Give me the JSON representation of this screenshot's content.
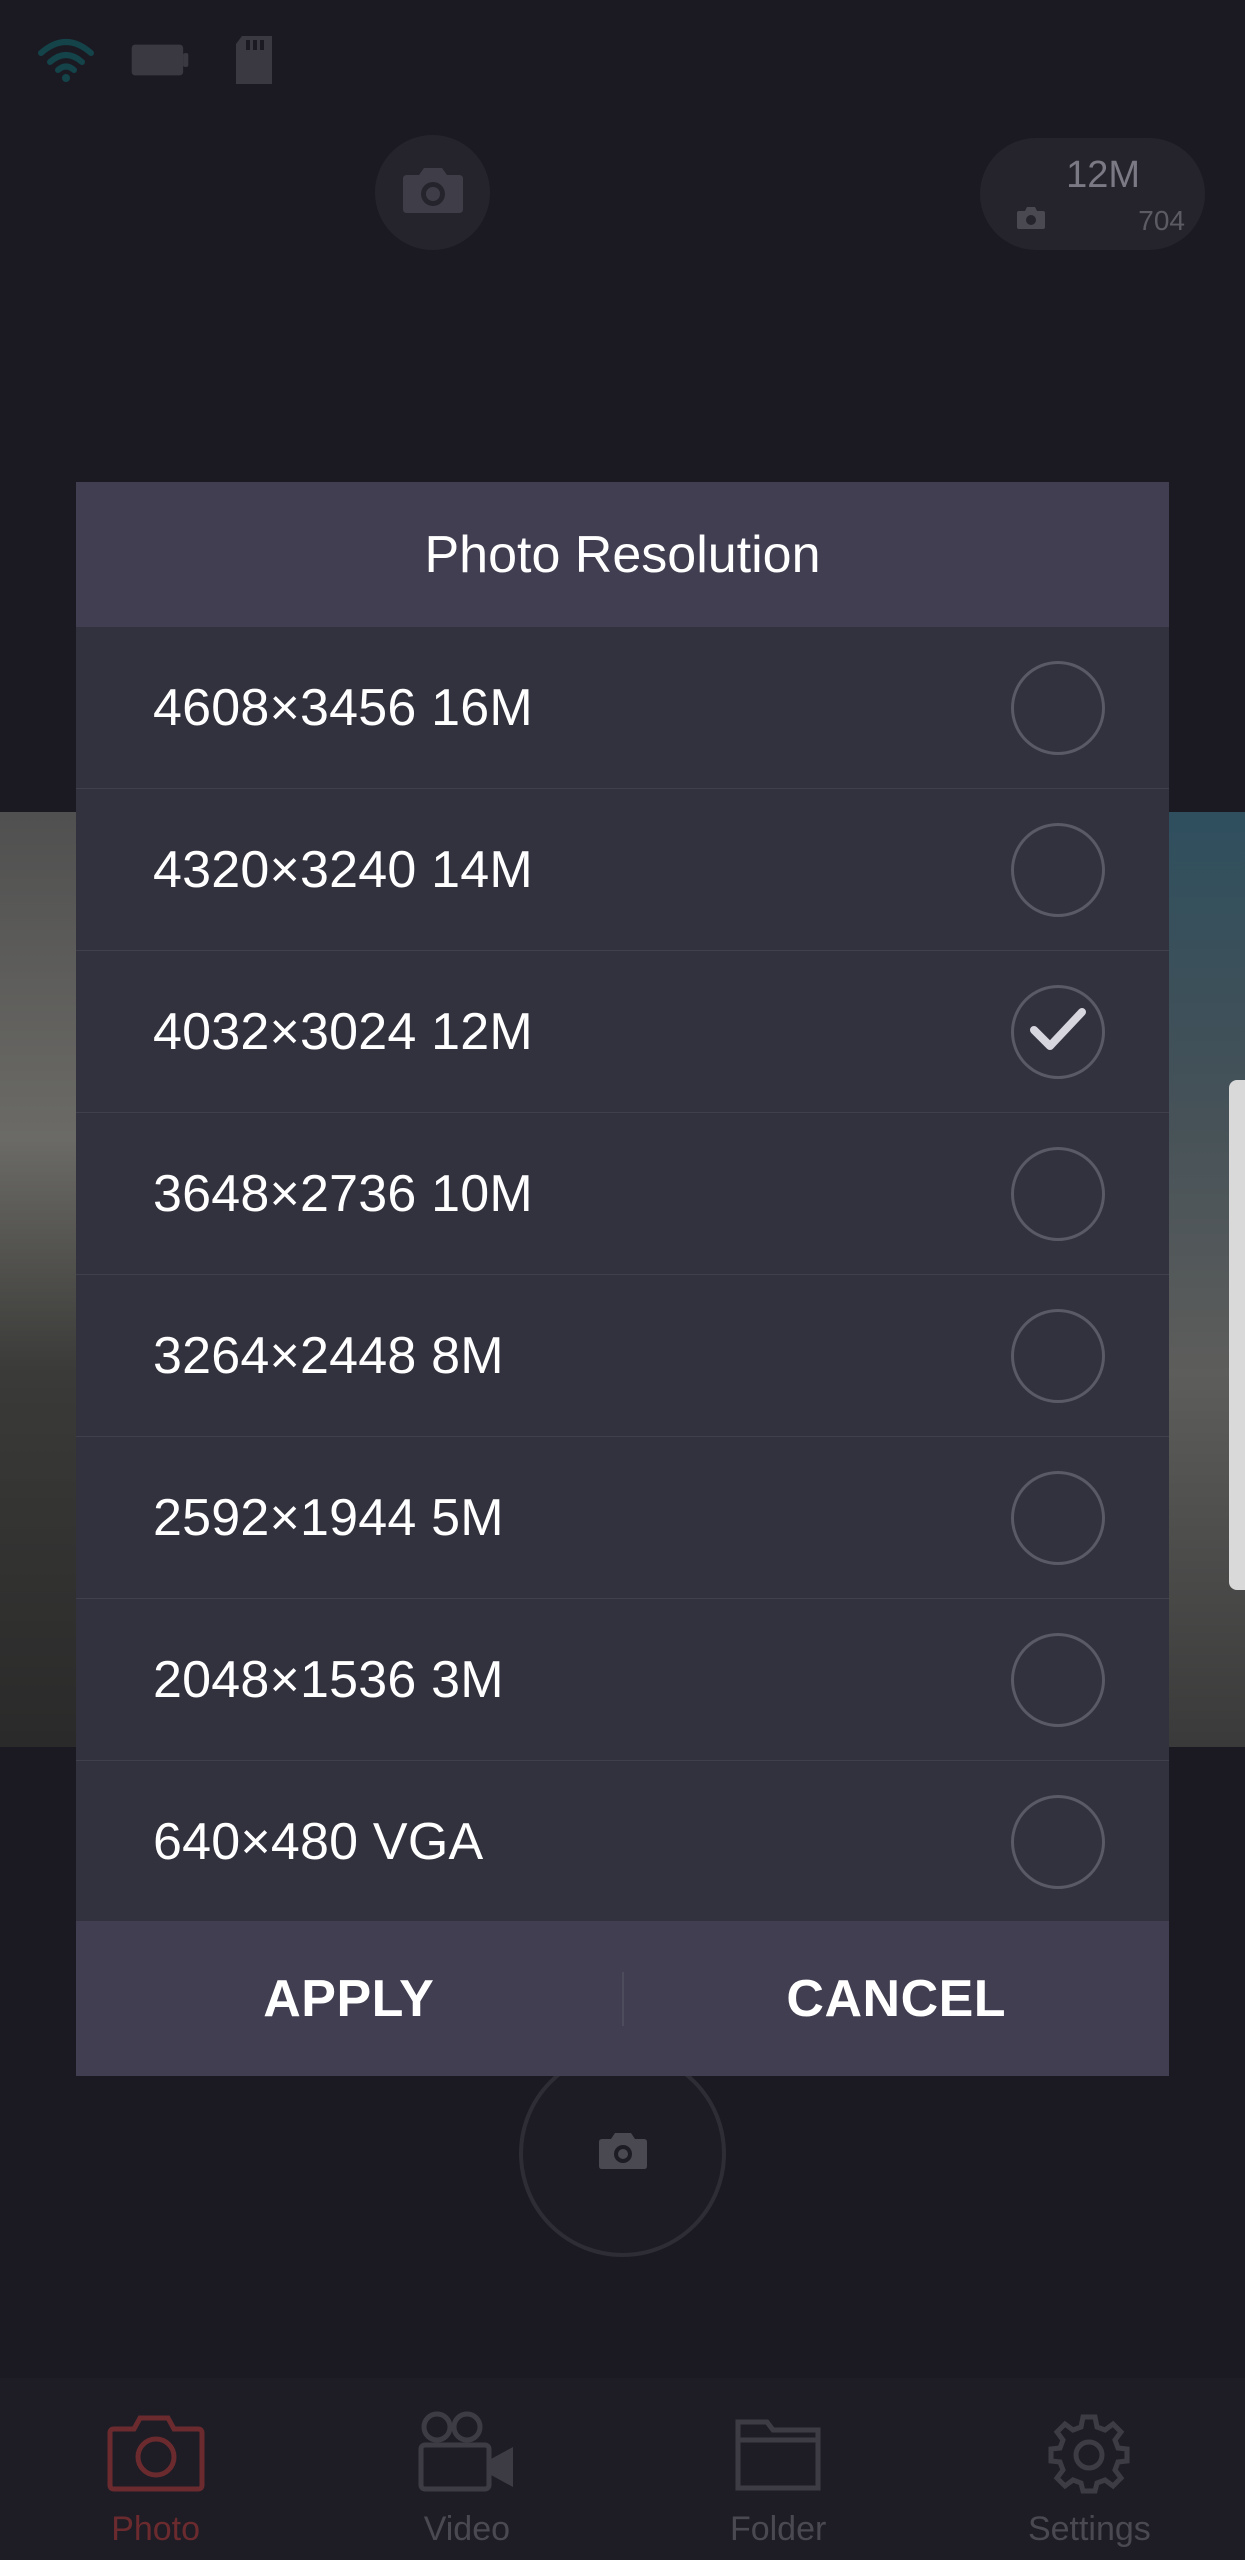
{
  "status_bar": {
    "icons": [
      "wifi-icon",
      "battery-icon",
      "sd-card-icon"
    ]
  },
  "resolution_badge": {
    "resolution": "12M",
    "remaining_shots": "704"
  },
  "dialog": {
    "title": "Photo Resolution",
    "options": [
      {
        "label": "4608×3456 16M",
        "selected": false
      },
      {
        "label": "4320×3240 14M",
        "selected": false
      },
      {
        "label": "4032×3024 12M",
        "selected": true
      },
      {
        "label": "3648×2736 10M",
        "selected": false
      },
      {
        "label": "3264×2448 8M",
        "selected": false
      },
      {
        "label": "2592×1944 5M",
        "selected": false
      },
      {
        "label": "2048×1536 3M",
        "selected": false
      },
      {
        "label": "640×480 VGA",
        "selected": false
      }
    ],
    "apply_label": "APPLY",
    "cancel_label": "CANCEL"
  },
  "bottom_nav": {
    "items": [
      {
        "label": "Photo",
        "icon": "camera-icon",
        "active": true
      },
      {
        "label": "Video",
        "icon": "video-camera-icon",
        "active": false
      },
      {
        "label": "Folder",
        "icon": "folder-icon",
        "active": false
      },
      {
        "label": "Settings",
        "icon": "gear-icon",
        "active": false
      }
    ]
  },
  "colors": {
    "dialog_bg": "#32313e",
    "dialog_header": "#403e50",
    "active_nav": "#6a2a2e",
    "background": "#1b1a22"
  }
}
